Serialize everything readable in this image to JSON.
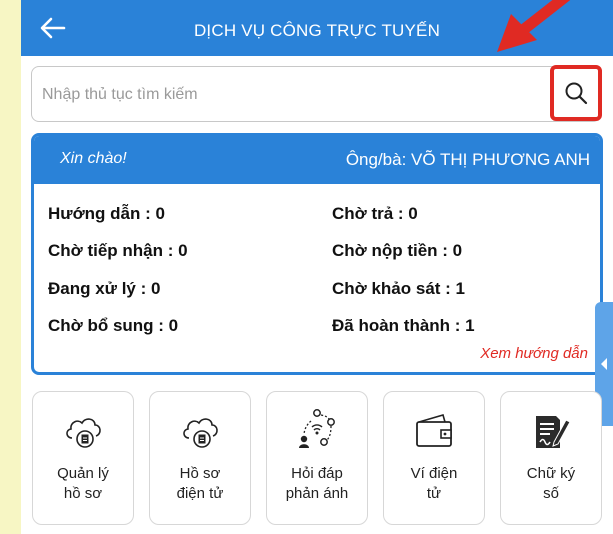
{
  "header": {
    "title": "DỊCH VỤ CÔNG TRỰC TUYẾN",
    "back_icon": "arrow-left-icon",
    "bg_color": "#2a82d8"
  },
  "search": {
    "placeholder": "Nhập thủ tục tìm kiếm",
    "value": "",
    "button_icon": "search-icon",
    "highlight_color": "#e02a23"
  },
  "greeting": {
    "hello": "Xin chào!",
    "user": "Ông/bà: VÕ THỊ PHƯƠNG ANH"
  },
  "stats": [
    {
      "label": "Hướng dẫn : 0"
    },
    {
      "label": "Chờ trả : 0"
    },
    {
      "label": "Chờ tiếp nhận : 0"
    },
    {
      "label": "Chờ nộp tiền : 0"
    },
    {
      "label": "Đang xử lý : 0"
    },
    {
      "label": "Chờ khảo sát : 1"
    },
    {
      "label": "Chờ bổ sung : 0"
    },
    {
      "label": "Đã hoàn thành : 1"
    }
  ],
  "guide_link": "Xem hướng dẫn",
  "menu": [
    {
      "label": "Quản lý\nhồ sơ",
      "icon": "cloud-document-icon"
    },
    {
      "label": "Hồ sơ\nđiện tử",
      "icon": "cloud-document-icon"
    },
    {
      "label": "Hỏi đáp\nphản ánh",
      "icon": "network-people-icon"
    },
    {
      "label": "Ví điện\ntử",
      "icon": "wallet-icon"
    },
    {
      "label": "Chữ ký\nsố",
      "icon": "signature-document-icon"
    }
  ]
}
